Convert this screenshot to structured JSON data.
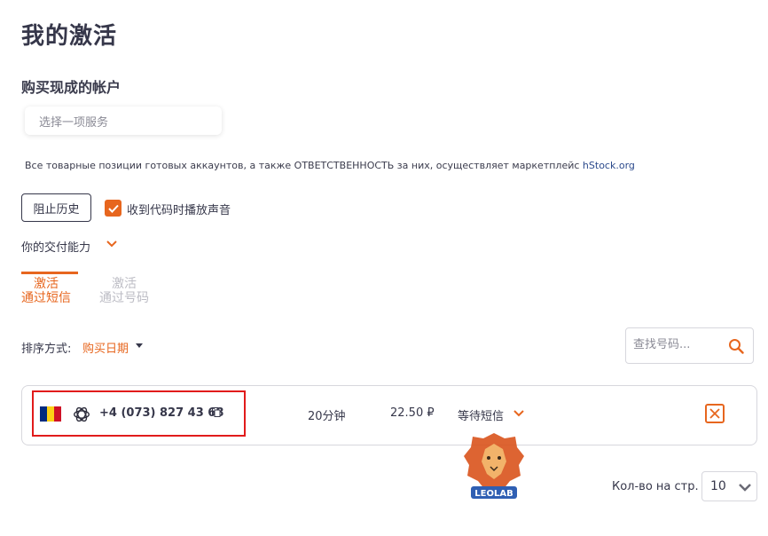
{
  "page": {
    "title": "我的激活",
    "buy_section_title": "购买现成的帐户"
  },
  "service_select": {
    "placeholder": "选择一项服务"
  },
  "disclaimer": {
    "text": "Все товарные позиции готовых аккаунтов, а также ОТВЕТСТВЕННОСТЬ за них, осуществляет маркетплейс ",
    "link": "hStock.org"
  },
  "controls": {
    "history_button": "阻止历史",
    "sound_checkbox_label": "收到代码时播放声音",
    "sound_checkbox_checked": true,
    "capacity_label": "你的交付能力"
  },
  "tabs": [
    {
      "line1": "激活",
      "line2": "通过短信",
      "active": true
    },
    {
      "line1": "激活",
      "line2": "通过号码",
      "active": false
    }
  ],
  "sort": {
    "label": "排序方式:",
    "value": "购买日期"
  },
  "search": {
    "placeholder": "查找号码..."
  },
  "activations": [
    {
      "country_flag": "romania-flag",
      "service_icon": "openai-icon",
      "phone": "+4 (073) 827 43 68",
      "duration": "20分钟",
      "price": "22.50 ₽",
      "status": "等待短信"
    }
  ],
  "watermark": {
    "text": "LEOLAB"
  },
  "pagination": {
    "per_page_label": "Кол-во на стр.",
    "per_page_value": "10"
  },
  "colors": {
    "accent": "#e7661e",
    "text": "#36374a",
    "highlight": "#e11b1b",
    "flag_blue": "#002b7f",
    "flag_yellow": "#fcd116",
    "flag_red": "#ce1126"
  }
}
